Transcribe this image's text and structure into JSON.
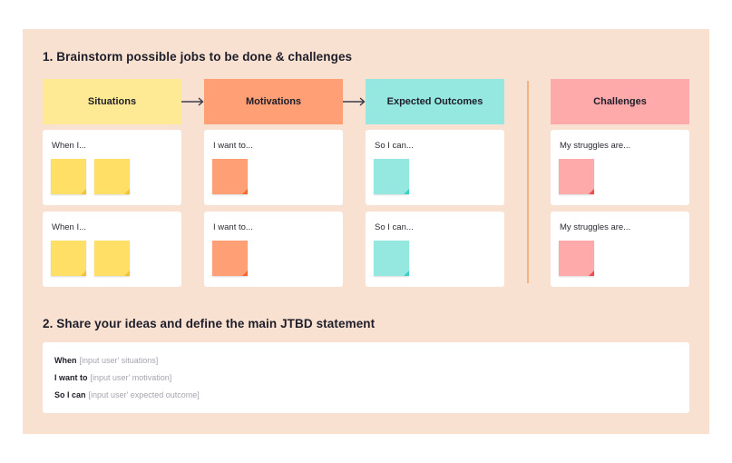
{
  "section1": {
    "title": "1. Brainstorm possible jobs to be done & challenges"
  },
  "columns": [
    {
      "header": "Situations",
      "color": "#fee994",
      "note_color": "#ffdf66",
      "fold_color": "#f2c230",
      "cards": [
        {
          "label": "When I...",
          "notes": 2
        },
        {
          "label": "When I...",
          "notes": 2
        }
      ]
    },
    {
      "header": "Motivations",
      "color": "#ff9f75",
      "note_color": "#ff9f75",
      "fold_color": "#f26a30",
      "cards": [
        {
          "label": "I want to...",
          "notes": 1
        },
        {
          "label": "I want to...",
          "notes": 1
        }
      ]
    },
    {
      "header": "Expected Outcomes",
      "color": "#94e8e0",
      "note_color": "#94e8e0",
      "fold_color": "#3fd0c2",
      "cards": [
        {
          "label": "So I can...",
          "notes": 1
        },
        {
          "label": "So I can...",
          "notes": 1
        }
      ]
    },
    {
      "header": "Challenges",
      "color": "#ffaaaa",
      "note_color": "#ffaaaa",
      "fold_color": "#f04c4c",
      "cards": [
        {
          "label": "My struggles are...",
          "notes": 1
        },
        {
          "label": "My struggles are...",
          "notes": 1
        }
      ]
    }
  ],
  "section2": {
    "title": "2. Share your ideas and define the main JTBD statement",
    "lines": [
      {
        "key": "When",
        "placeholder": "[input user' situations]"
      },
      {
        "key": "I want to",
        "placeholder": "[input user' motivation]"
      },
      {
        "key": "So I can",
        "placeholder": "[input user' expected outcome]"
      }
    ]
  },
  "colors": {
    "board_bg": "#f8e1d0",
    "divider": "#f5b27e",
    "arrow": "#3a3a4a"
  }
}
